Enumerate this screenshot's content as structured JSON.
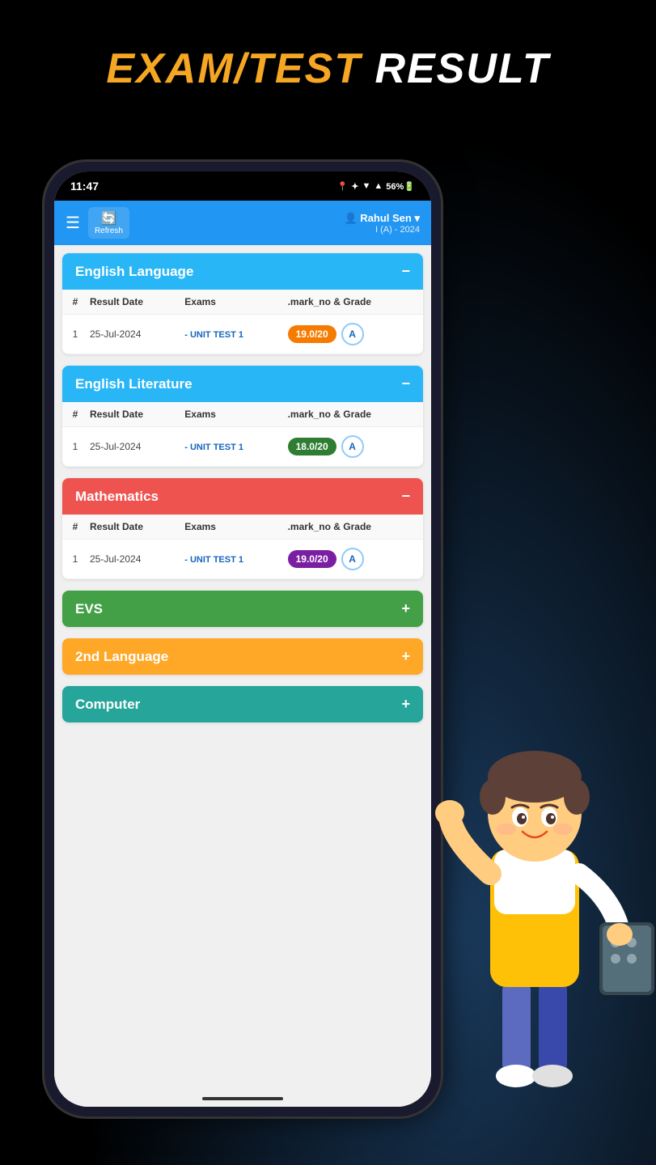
{
  "page": {
    "title_orange": "EXAM/TEST",
    "title_white": " RESULT"
  },
  "status_bar": {
    "time": "11:47",
    "icons": "● ✦ ▼ ▲ 56%🔋"
  },
  "header": {
    "refresh_label": "Refresh",
    "user_name": "👤 Rahul Sen ▾",
    "user_class": "I (A) - 2024"
  },
  "subjects": [
    {
      "id": "english-language",
      "name": "English Language",
      "color": "blue",
      "collapsed": false,
      "rows": [
        {
          "num": "1",
          "date": "25-Jul-2024",
          "exam": "- UNIT TEST 1",
          "marks": "19.0/20",
          "marks_color": "orange-badge",
          "grade": "A"
        }
      ]
    },
    {
      "id": "english-literature",
      "name": "English Literature",
      "color": "blue",
      "collapsed": false,
      "rows": [
        {
          "num": "1",
          "date": "25-Jul-2024",
          "exam": "- UNIT TEST 1",
          "marks": "18.0/20",
          "marks_color": "green-badge",
          "grade": "A"
        }
      ]
    },
    {
      "id": "mathematics",
      "name": "Mathematics",
      "color": "red",
      "collapsed": false,
      "rows": [
        {
          "num": "1",
          "date": "25-Jul-2024",
          "exam": "- UNIT TEST 1",
          "marks": "19.0/20",
          "marks_color": "purple-badge",
          "grade": "A"
        }
      ]
    },
    {
      "id": "evs",
      "name": "EVS",
      "color": "green",
      "collapsed": true,
      "rows": []
    },
    {
      "id": "2nd-language",
      "name": "2nd Language",
      "color": "orange",
      "collapsed": true,
      "rows": []
    },
    {
      "id": "computer",
      "name": "Computer",
      "color": "teal",
      "collapsed": true,
      "rows": []
    }
  ],
  "table_headers": {
    "num": "#",
    "date": "Result Date",
    "exam": "Exams",
    "marks_grade": ".mark_no & Grade"
  },
  "collapse_icon": "−",
  "expand_icon": "+"
}
